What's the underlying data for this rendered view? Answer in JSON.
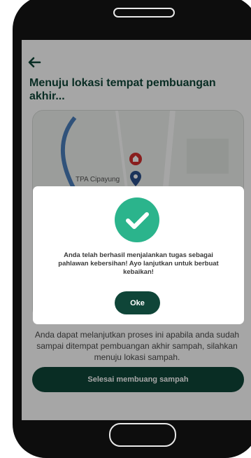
{
  "header": {
    "back_icon": "arrow-left-icon",
    "title": "Menuju lokasi tempat pembuangan akhir..."
  },
  "map": {
    "place_label": "TPA Cipayung",
    "marker_icon": "map-pin-icon",
    "landmark_icon": "red-landmark-icon"
  },
  "info": {
    "text": "Anda dapat melanjutkan proses ini apabila anda sudah sampai  ditempat pembuangan akhir sampah, silahkan menuju lokasi sampah."
  },
  "actions": {
    "finish_label": "Selesai membuang sampah"
  },
  "dialog": {
    "icon": "check-circle-icon",
    "message": "Anda telah berhasil menjalankan tugas sebagai pahlawan kebersihan! Ayo lanjutkan untuk berbuat kebaikan!",
    "ok_label": "Oke"
  },
  "colors": {
    "primary": "#0f4538",
    "success": "#2bb48c",
    "overlay": "rgba(0,0,0,0.35)"
  }
}
